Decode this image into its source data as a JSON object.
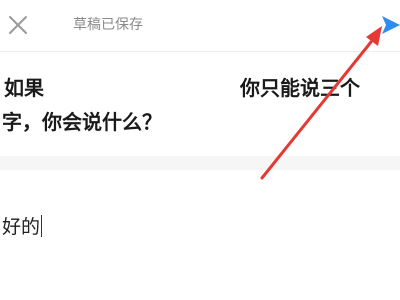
{
  "header": {
    "close_icon": "close-icon",
    "status": "草稿已保存",
    "send_icon": "send-icon"
  },
  "question": {
    "line1_part1": "如果",
    "line1_part2": "你只能说三个",
    "line2": "字，你会说什么？"
  },
  "answer": {
    "value": "好的"
  },
  "colors": {
    "send": "#2f8cf0",
    "annotation_arrow": "#e53935",
    "status_text": "#8a8a8a",
    "close_icon": "#9a9a9a"
  }
}
